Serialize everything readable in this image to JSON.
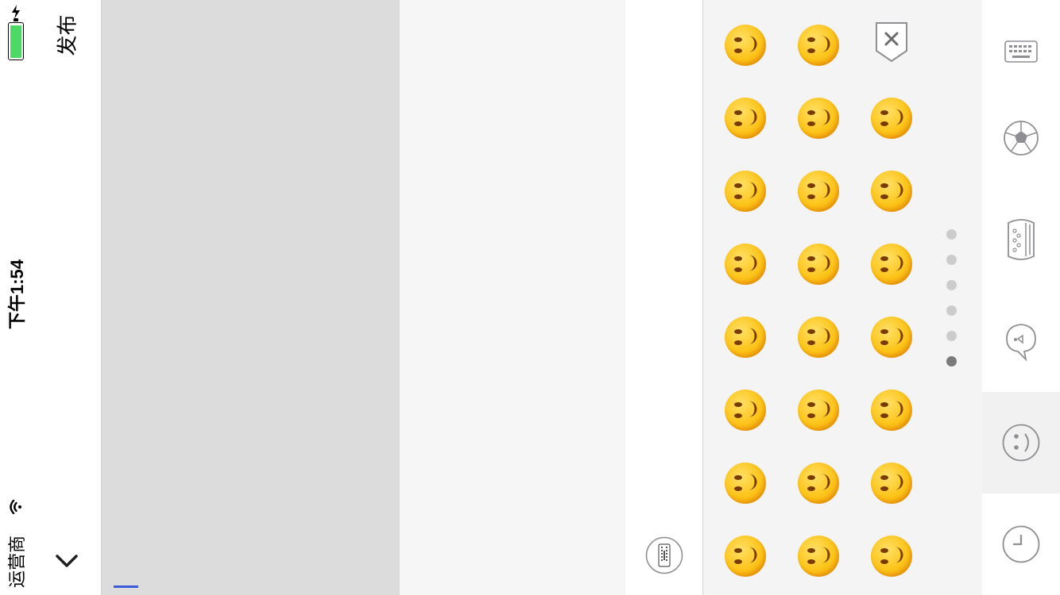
{
  "status_bar": {
    "carrier": "运营商",
    "time": "下午1:54",
    "battery_color": "#4cd964"
  },
  "nav": {
    "publish_label": "发布",
    "collapse_icon": "chevron-down-icon"
  },
  "input": {
    "cursor_color": "#3b5bdb"
  },
  "keyboard_toggle": {
    "icon": "keyboard-icon"
  },
  "emoji_panel": {
    "delete_icon": "backspace-icon",
    "page_count": 6,
    "active_page": 5,
    "rows": 8,
    "cols": 3
  },
  "categories": [
    {
      "name": "keyboard-category",
      "icon": "keyboard-icon",
      "selected": false
    },
    {
      "name": "sports-category",
      "icon": "soccer-ball-icon",
      "selected": false
    },
    {
      "name": "food-category",
      "icon": "burger-icon",
      "selected": false
    },
    {
      "name": "animal-category",
      "icon": "bird-icon",
      "selected": false
    },
    {
      "name": "smiley-category",
      "icon": "smiley-icon",
      "selected": true
    },
    {
      "name": "recent-category",
      "icon": "clock-icon",
      "selected": false
    }
  ]
}
